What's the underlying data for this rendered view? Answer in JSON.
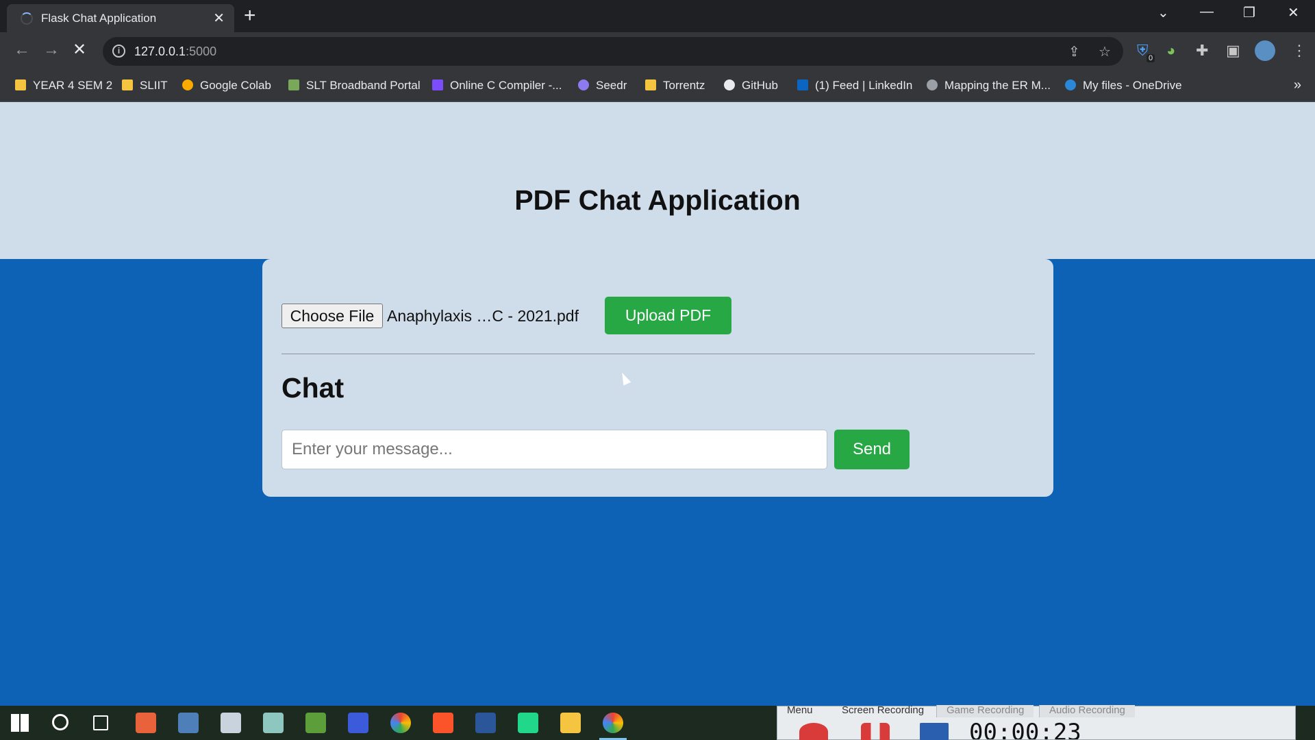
{
  "browser": {
    "tab_title": "Flask Chat Application",
    "url_host": "127.0.0.1",
    "url_port": ":5000",
    "extension_badge": "0",
    "bookmarks": [
      {
        "label": "YEAR 4 SEM 2",
        "icon": "folder-icon",
        "color": "#f5c542"
      },
      {
        "label": "SLIIT",
        "icon": "folder-icon",
        "color": "#f5c542"
      },
      {
        "label": "Google Colab",
        "icon": "colab-icon",
        "color": "#f9ab00"
      },
      {
        "label": "SLT Broadband Portal",
        "icon": "slt-icon",
        "color": "#7aa85a"
      },
      {
        "label": "Online C Compiler -...",
        "icon": "bolt-icon",
        "color": "#7c4dff"
      },
      {
        "label": "Seedr",
        "icon": "seedr-icon",
        "color": "#8a7cf0"
      },
      {
        "label": "Torrentz",
        "icon": "folder-icon",
        "color": "#f5c542"
      },
      {
        "label": "GitHub",
        "icon": "github-icon",
        "color": "#e8eaed"
      },
      {
        "label": "(1) Feed | LinkedIn",
        "icon": "linkedin-icon",
        "color": "#0a66c2"
      },
      {
        "label": "Mapping the ER M...",
        "icon": "globe-icon",
        "color": "#9aa0a6"
      },
      {
        "label": "My files - OneDrive",
        "icon": "onedrive-icon",
        "color": "#2b88d8"
      }
    ]
  },
  "page": {
    "title": "PDF Chat Application",
    "choose_file_label": "Choose File",
    "file_name": "Anaphylaxis …C - 2021.pdf",
    "upload_label": "Upload PDF",
    "chat_heading": "Chat",
    "message_placeholder": "Enter your message...",
    "send_label": "Send"
  },
  "recorder": {
    "tabs": [
      "Menu",
      "Screen Recording",
      "Game Recording",
      "Audio Recording"
    ],
    "elapsed": "00:00:23"
  },
  "colors": {
    "page_background": "#0d62b6",
    "header_background": "#cfdcea",
    "button_green": "#28a745"
  }
}
